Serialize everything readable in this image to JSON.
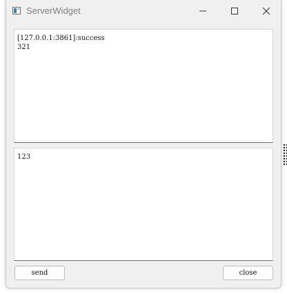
{
  "window": {
    "title": "ServerWidget",
    "icon": "app-window-icon",
    "controls": [
      "minimize-icon",
      "maximize-icon",
      "close-icon"
    ]
  },
  "receive_area": {
    "text": "[127.0.0.1:3861]:success\n321"
  },
  "send_area": {
    "text": "123"
  },
  "buttons": {
    "send_label": "send",
    "close_label": "close"
  },
  "colors": {
    "window_bg": "#f0f0f0",
    "title_text": "#808080",
    "pane_bg": "#ffffff"
  }
}
